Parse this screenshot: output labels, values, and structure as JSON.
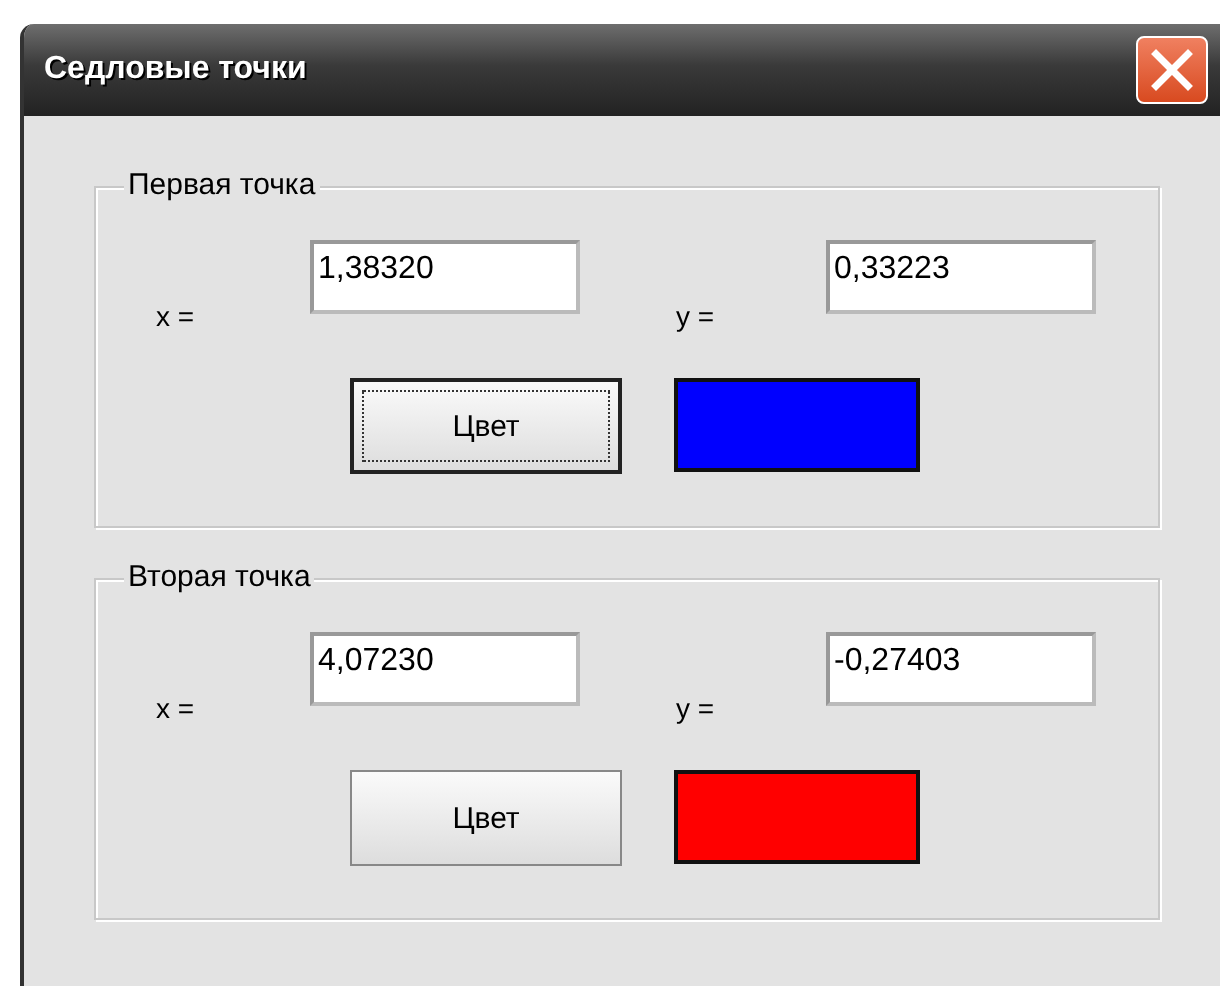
{
  "window": {
    "title": "Седловые точки"
  },
  "groups": [
    {
      "title": "Первая точка",
      "x_label": "x =",
      "x_value": "1,38320",
      "y_label": "y =",
      "y_value": "0,33223",
      "button": {
        "label": "Цвет",
        "focused": true
      },
      "color": "#0000ff"
    },
    {
      "title": "Вторая точка",
      "x_label": "x =",
      "x_value": "4,07230",
      "y_label": "y =",
      "y_value": "-0,27403",
      "button": {
        "label": "Цвет",
        "focused": false
      },
      "color": "#ff0000"
    }
  ]
}
